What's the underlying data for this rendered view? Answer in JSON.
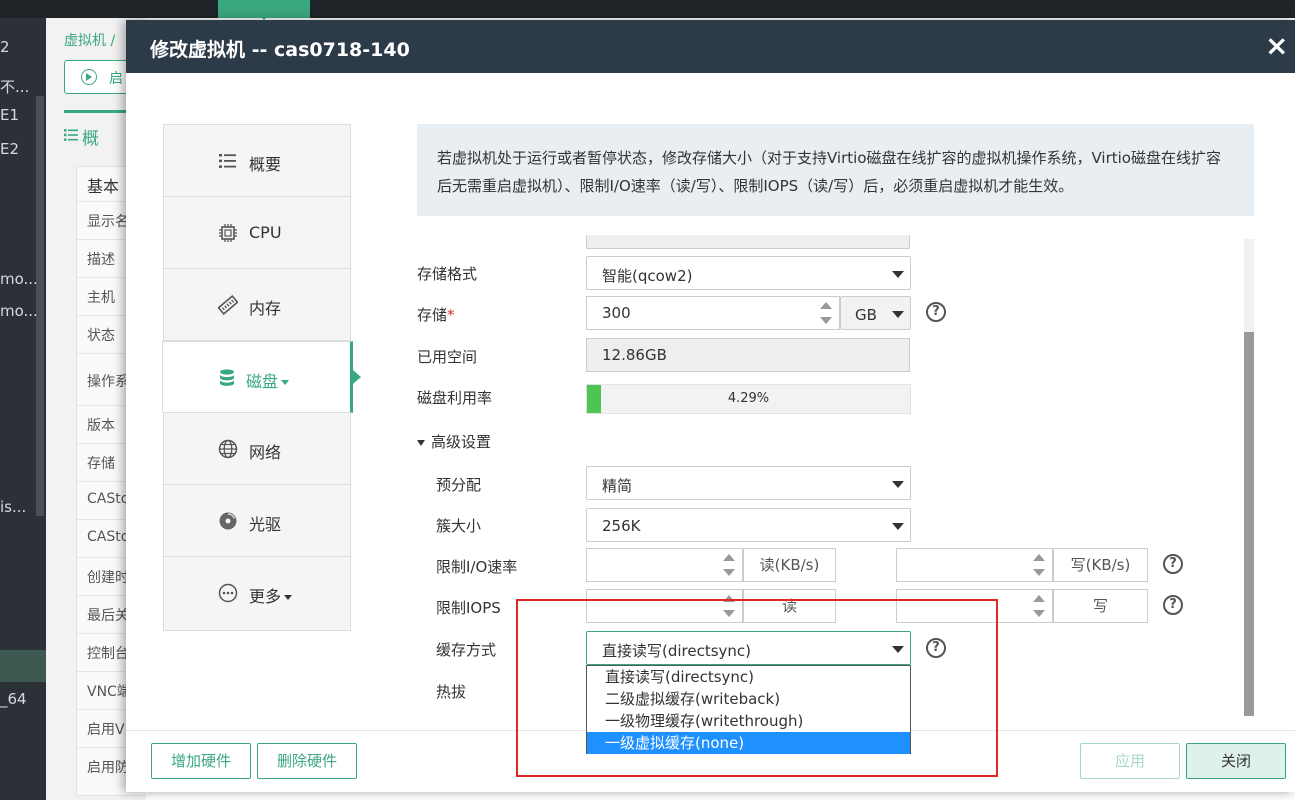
{
  "background": {
    "left_nav": [
      "2",
      "不...",
      "E1",
      "E2",
      "mo...",
      "mo...",
      "is...",
      "_64"
    ],
    "breadcrumb": "虚拟机 /",
    "start_button": "启",
    "section": "概",
    "table_header": "基本",
    "table_rows": [
      "显示名",
      "描述",
      "主机",
      "状态",
      "操作系",
      "版本",
      "存储",
      "CASto",
      "CASto",
      "创建时",
      "最后关",
      "控制台",
      "VNC端",
      "启用V",
      "启用防"
    ]
  },
  "modal": {
    "title": "修改虚拟机 -- cas0718-140",
    "close_icon": "×",
    "side_menu": [
      {
        "label": "概要",
        "icon": "list-icon"
      },
      {
        "label": "CPU",
        "icon": "cpu-icon"
      },
      {
        "label": "内存",
        "icon": "memory-icon"
      },
      {
        "label": "磁盘",
        "icon": "database-icon",
        "active": true
      },
      {
        "label": "网络",
        "icon": "globe-icon"
      },
      {
        "label": "光驱",
        "icon": "disc-icon"
      },
      {
        "label": "更多",
        "icon": "more-icon"
      }
    ],
    "info_text": "若虚拟机处于运行或者暂停状态，修改存储大小（对于支持Virtio磁盘在线扩容的虚拟机操作系统，Virtio磁盘在线扩容后无需重启虚拟机）、限制I/O速率（读/写）、限制IOPS（读/写）后，必须重启虚拟机才能生效。",
    "form": {
      "storage_format": {
        "label": "存储格式",
        "value": "智能(qcow2)"
      },
      "storage": {
        "label": "存储",
        "value": "300",
        "unit": "GB"
      },
      "used_space": {
        "label": "已用空间",
        "value": "12.86GB"
      },
      "disk_usage": {
        "label": "磁盘利用率",
        "percent_text": "4.29%",
        "percent": 4.29
      },
      "advanced": {
        "label": "高级设置"
      },
      "preallocation": {
        "label": "预分配",
        "value": "精简"
      },
      "cluster_size": {
        "label": "簇大小",
        "value": "256K"
      },
      "io_rate": {
        "label": "限制I/O速率",
        "read_unit": "读(KB/s)",
        "write_unit": "写(KB/s)",
        "read_value": "",
        "write_value": ""
      },
      "iops": {
        "label": "限制IOPS",
        "read_unit": "读",
        "write_unit": "写",
        "read_value": "",
        "write_value": ""
      },
      "cache_mode": {
        "label": "缓存方式",
        "value": "直接读写(directsync)",
        "options": [
          "直接读写(directsync)",
          "二级虚拟缓存(writeback)",
          "一级物理缓存(writethrough)",
          "一级虚拟缓存(none)"
        ],
        "highlighted_index": 3
      },
      "hotplug": {
        "label": "热拔"
      }
    },
    "footer": {
      "add_hardware": "增加硬件",
      "remove_hardware": "删除硬件",
      "apply": "应用",
      "close": "关闭"
    },
    "colors": {
      "accent": "#3aa87f",
      "header": "#2d3a47",
      "selected_option": "#1e90ff",
      "annotation": "#e02626"
    }
  }
}
